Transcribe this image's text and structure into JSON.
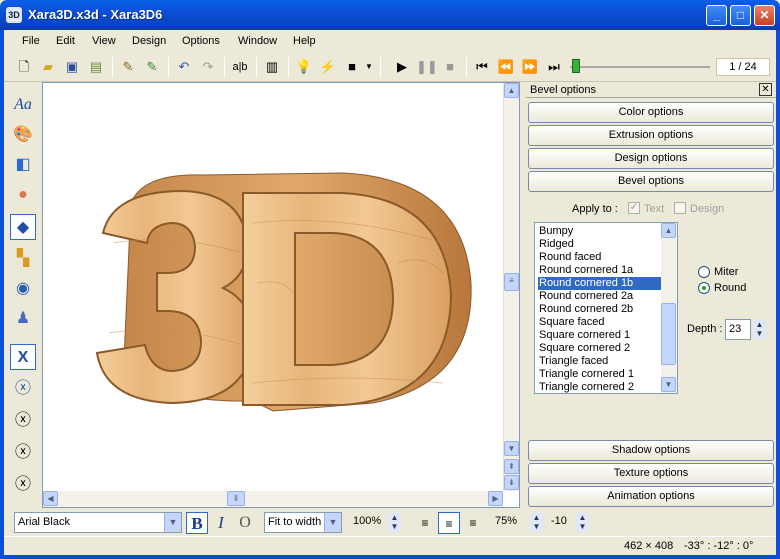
{
  "window": {
    "title": "Xara3D.x3d - Xara3D6",
    "app_icon_label": "3D"
  },
  "menu": [
    "File",
    "Edit",
    "View",
    "Design",
    "Options",
    "Window",
    "Help"
  ],
  "toolbar": {
    "frame_counter": "1 / 24"
  },
  "panel": {
    "header": "Bevel options",
    "top_sections": [
      "Color options",
      "Extrusion options",
      "Design options",
      "Bevel options"
    ],
    "apply_to_label": "Apply to :",
    "apply_text": "Text",
    "apply_design": "Design",
    "bevel_styles": [
      "Bumpy",
      "Ridged",
      "Round faced",
      "Round cornered 1a",
      "Round cornered 1b",
      "Round cornered 2a",
      "Round cornered 2b",
      "Square faced",
      "Square cornered 1",
      "Square cornered 2",
      "Triangle faced",
      "Triangle cornered 1",
      "Triangle cornered 2"
    ],
    "selected_style": "Round cornered 1b",
    "join_options": {
      "miter": "Miter",
      "round": "Round",
      "selected": "Round"
    },
    "depth_label": "Depth :",
    "depth_value": "23",
    "bottom_sections": [
      "Shadow options",
      "Texture options",
      "Animation options"
    ]
  },
  "canvas_text": "3D",
  "bottom": {
    "font": "Arial Black",
    "bold": "B",
    "italic": "I",
    "outline": "O",
    "fit": "Fit to width",
    "zoom": "100%",
    "line_spacing": "75%",
    "char_spacing": "-10"
  },
  "status": {
    "dimensions": "462 × 408",
    "angles": "-33° : -12° : 0°"
  },
  "colors": {
    "title_blue": "#0b4fd6",
    "selection": "#316ac5",
    "wood_light": "#f0c896",
    "wood_dark": "#b7773c"
  }
}
